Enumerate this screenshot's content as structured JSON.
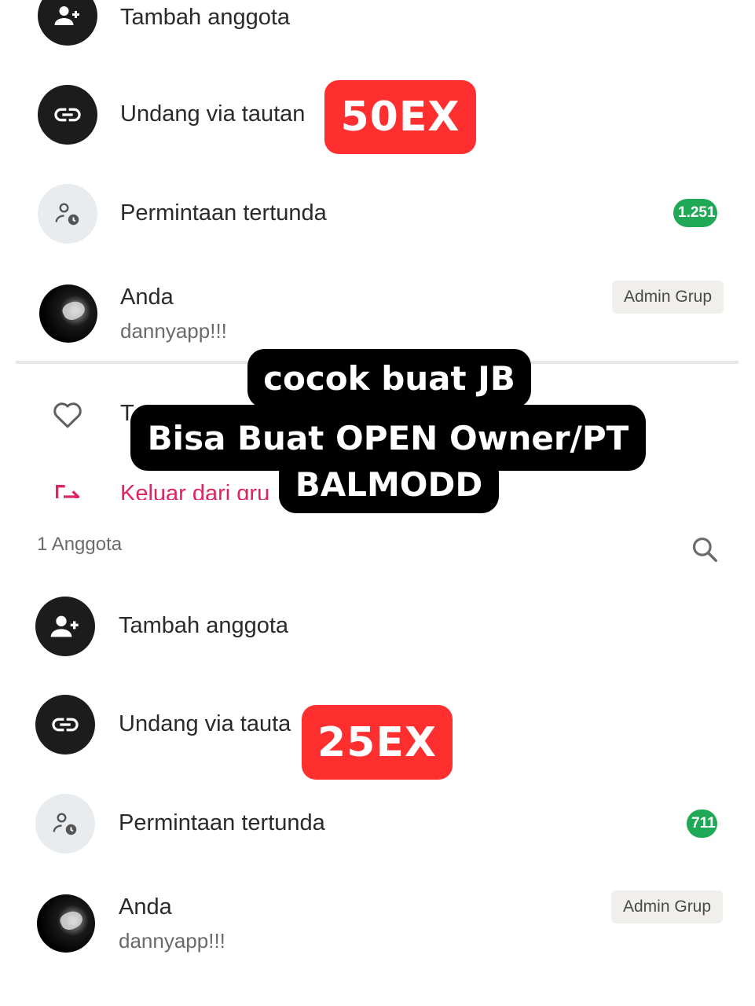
{
  "top": {
    "add_member": "Tambah anggota",
    "invite_link": "Undang via tautan",
    "pending_requests": "Permintaan tertunda",
    "pending_count": "1.251",
    "you_name": "Anda",
    "you_status": "dannyapp!!!",
    "admin_badge": "Admin Grup",
    "favorite_label": "T",
    "exit_label": "Keluar dari gru",
    "price_tag": "50EX"
  },
  "overlay": {
    "line1": "cocok buat JB",
    "line2": "Bisa Buat OPEN Owner/PT",
    "line3": "BALMODD"
  },
  "bottom": {
    "member_count": "1 Anggota",
    "add_member": "Tambah anggota",
    "invite_link": "Undang via tauta",
    "pending_requests": "Permintaan tertunda",
    "pending_count": "711",
    "you_name": "Anda",
    "you_status": "dannyapp!!!",
    "admin_badge": "Admin Grup",
    "price_tag": "25EX"
  },
  "colors": {
    "promo_red": "#ff2f2f",
    "badge_green": "#1fa855",
    "icon_dark": "#1c1c1c",
    "exit_red": "#e0245e"
  }
}
